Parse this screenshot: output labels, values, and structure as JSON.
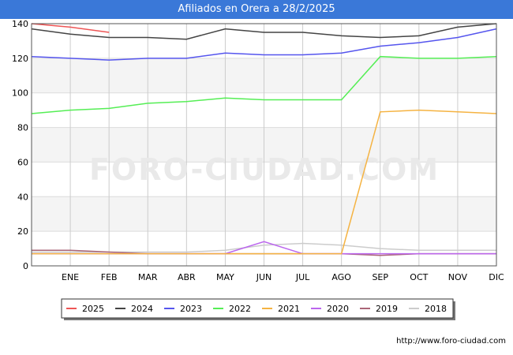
{
  "chart_data": {
    "type": "line",
    "title": "Afiliados en Orera a 28/2/2025",
    "categories": [
      "",
      "ENE",
      "FEB",
      "MAR",
      "ABR",
      "MAY",
      "JUN",
      "JUL",
      "AGO",
      "SEP",
      "OCT",
      "NOV",
      "DIC"
    ],
    "ylim": [
      0,
      140
    ],
    "yticks": [
      0,
      20,
      40,
      60,
      80,
      100,
      120,
      140
    ],
    "grid": true,
    "legend_position": "bottom",
    "series": [
      {
        "name": "2025",
        "color": "#ee5555",
        "values": [
          140,
          138,
          135
        ]
      },
      {
        "name": "2024",
        "color": "#444444",
        "values": [
          137,
          134,
          132,
          132,
          131,
          137,
          135,
          135,
          133,
          132,
          133,
          138,
          140
        ]
      },
      {
        "name": "2023",
        "color": "#5555ee",
        "values": [
          121,
          120,
          119,
          120,
          120,
          123,
          122,
          122,
          123,
          127,
          129,
          132,
          137
        ]
      },
      {
        "name": "2022",
        "color": "#55ee55",
        "values": [
          88,
          90,
          91,
          94,
          95,
          97,
          96,
          96,
          96,
          121,
          120,
          120,
          121
        ]
      },
      {
        "name": "2021",
        "color": "#f5b342",
        "values": [
          7,
          7,
          7,
          7,
          7,
          7,
          7,
          7,
          7,
          89,
          90,
          89,
          88
        ]
      },
      {
        "name": "2020",
        "color": "#bb66ee",
        "values": [
          7,
          7,
          7,
          7,
          7,
          7,
          14,
          7,
          7,
          7,
          7,
          7,
          7
        ]
      },
      {
        "name": "2019",
        "color": "#aa6677",
        "values": [
          9,
          9,
          8,
          7,
          7,
          7,
          7,
          7,
          7,
          6,
          7,
          7,
          7
        ]
      },
      {
        "name": "2018",
        "color": "#cccccc",
        "values": [
          8,
          8,
          8,
          8,
          8,
          9,
          12,
          13,
          12,
          10,
          9,
          9,
          9
        ]
      }
    ]
  },
  "watermark": "FORO-CIUDAD.COM",
  "footer_url": "http://www.foro-ciudad.com"
}
